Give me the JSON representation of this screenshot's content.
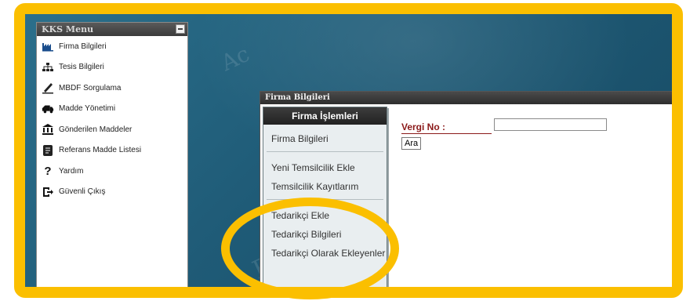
{
  "menu": {
    "title": "KKS Menu",
    "items": [
      {
        "label": "Firma Bilgileri",
        "icon": "factory-icon"
      },
      {
        "label": "Tesis Bilgileri",
        "icon": "org-chart-icon"
      },
      {
        "label": "MBDF Sorgulama",
        "icon": "pen-icon"
      },
      {
        "label": "Madde Yönetimi",
        "icon": "truck-icon"
      },
      {
        "label": "Gönderilen Maddeler",
        "icon": "bank-icon"
      },
      {
        "label": "Referans Madde Listesi",
        "icon": "document-icon"
      },
      {
        "label": "Yardım",
        "icon": "question-icon"
      },
      {
        "label": "Güvenli Çıkış",
        "icon": "logout-icon"
      }
    ]
  },
  "window": {
    "title": "Firma Bilgileri",
    "sidebar": {
      "title": "Firma İşlemleri",
      "items": [
        "Firma Bilgileri",
        "Yeni Temsilcilik Ekle",
        "Temsilcilik Kayıtlarım",
        "Tedarikçi Ekle",
        "Tedarikçi Bilgileri",
        "Tedarikçi Olarak Ekleyenler"
      ]
    },
    "form": {
      "vergi_label": "Vergi No :",
      "vergi_value": "",
      "search_button": "Ara"
    }
  },
  "background_text": [
    "Ac",
    "Bn"
  ],
  "colors": {
    "highlight": "#fbbf00",
    "background": "#1f5b77",
    "label": "#8b1a1a"
  }
}
